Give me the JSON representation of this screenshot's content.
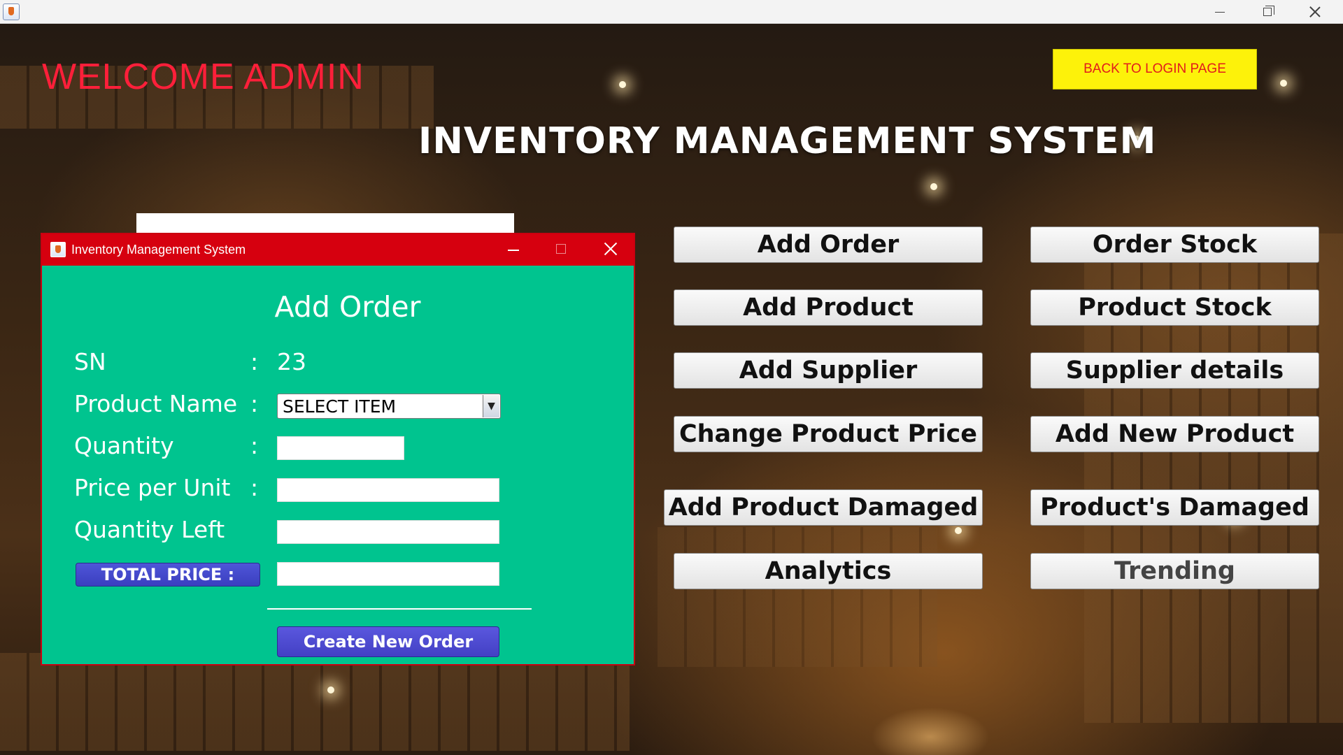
{
  "window": {
    "controls": [
      "minimize",
      "restore",
      "close"
    ]
  },
  "header": {
    "welcome": "WELCOME ADMIN",
    "back_button": "BACK TO LOGIN PAGE",
    "title": "INVENTORY MANAGEMENT SYSTEM"
  },
  "menu": {
    "left": [
      "Add Order",
      "Add Product",
      "Add Supplier",
      "Change Product Price",
      "Add Product Damaged",
      "Analytics"
    ],
    "right": [
      "Order Stock",
      "Product Stock",
      "Supplier details",
      "Add New Product",
      "Product's Damaged",
      "Trending"
    ]
  },
  "dialog": {
    "title": "Inventory Management System",
    "heading": "Add Order",
    "sn_label": "SN",
    "sn_value": "23",
    "product_name_label": "Product Name",
    "product_name_selected": "SELECT ITEM",
    "quantity_label": "Quantity",
    "price_per_unit_label": "Price per Unit",
    "quantity_left_label": "Quantity Left",
    "total_price_label": "TOTAL PRICE :",
    "colon": ":",
    "quantity_value": "",
    "price_per_unit_value": "",
    "quantity_left_value": "",
    "total_price_value": "",
    "create_button": "Create New Order"
  },
  "colors": {
    "dialog_bg": "#00c48f",
    "dialog_title_bar": "#d6000f",
    "welcome_text": "#ff1f3a",
    "back_button_bg": "#fdf20a",
    "action_button_bg": "#4340c4"
  }
}
